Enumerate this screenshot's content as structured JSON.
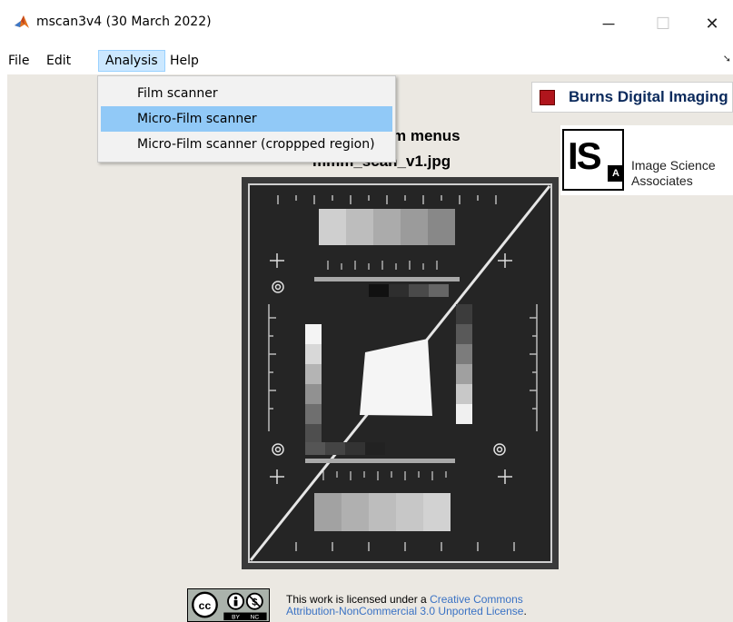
{
  "window": {
    "title": "mscan3v4  (30 March 2022)",
    "minimize": "─",
    "maximize": "☐",
    "close": "✕",
    "colors": {
      "canvas": "#ebe8e2",
      "menu_highlight": "#91c9f7",
      "active_menu": "#cce8ff"
    }
  },
  "menubar": {
    "items": [
      {
        "label": "File"
      },
      {
        "label": "Edit"
      },
      {
        "label": "Analysis"
      },
      {
        "label": "Help"
      }
    ],
    "overflow_icon": "pin-icon"
  },
  "dropdown": {
    "items": [
      {
        "label": "Film scanner"
      },
      {
        "label": "Micro-Film scanner"
      },
      {
        "label": "Micro-Film scanner (croppped region)"
      }
    ]
  },
  "heading": {
    "line1": "m menus",
    "line2": "mmm_scan_v1.jpg"
  },
  "logos": {
    "burns": "Burns Digital Imaging",
    "isa_mark": "IS",
    "isa_sub": "A",
    "isa_line1": "Image Science",
    "isa_line2": "Associates"
  },
  "license": {
    "prefix": "This work is licensed under a ",
    "link1": "Creative Commons",
    "link2": "Attribution-NonCommercial 3.0 Unported License",
    "suffix": ".",
    "badge_by": "BY",
    "badge_nc": "NC"
  }
}
